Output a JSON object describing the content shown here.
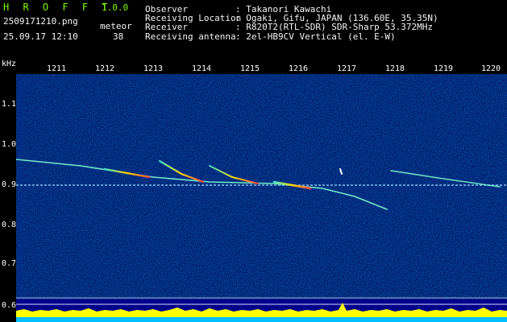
{
  "app": {
    "name": "H R O F F T",
    "version": "1.0.0"
  },
  "file": {
    "name": "2509171210.png",
    "datetime": "25.09.17 12:10"
  },
  "counter": {
    "label": "meteor",
    "count": "38"
  },
  "info": {
    "observer_label": "Observer",
    "observer_value": ": Takanori Kawachi",
    "location_label": "Receiving Location",
    "location_value": ": Ogaki, Gifu, JAPAN (136.60E, 35.35N)",
    "receiver_label": "Receiver",
    "receiver_value": ": R820T2(RTL-SDR) SDR-Sharp 53.372MHz",
    "antenna_label": "Receiving antenna",
    "antenna_value": ": 2el-HB9CV Vertical (el. E-W)"
  },
  "axis": {
    "y_unit": "kHz",
    "x_ticks": [
      "1211",
      "1212",
      "1213",
      "1214",
      "1215",
      "1216",
      "1217",
      "1218",
      "1219",
      "1220"
    ],
    "y_ticks": [
      "1.1",
      "1.0",
      "0.9",
      "0.8",
      "0.7",
      "0.6"
    ]
  },
  "colors": {
    "background": "#00008b",
    "trace": "#7fffd4",
    "bars": "#ffff00",
    "level": "#00bfff"
  }
}
